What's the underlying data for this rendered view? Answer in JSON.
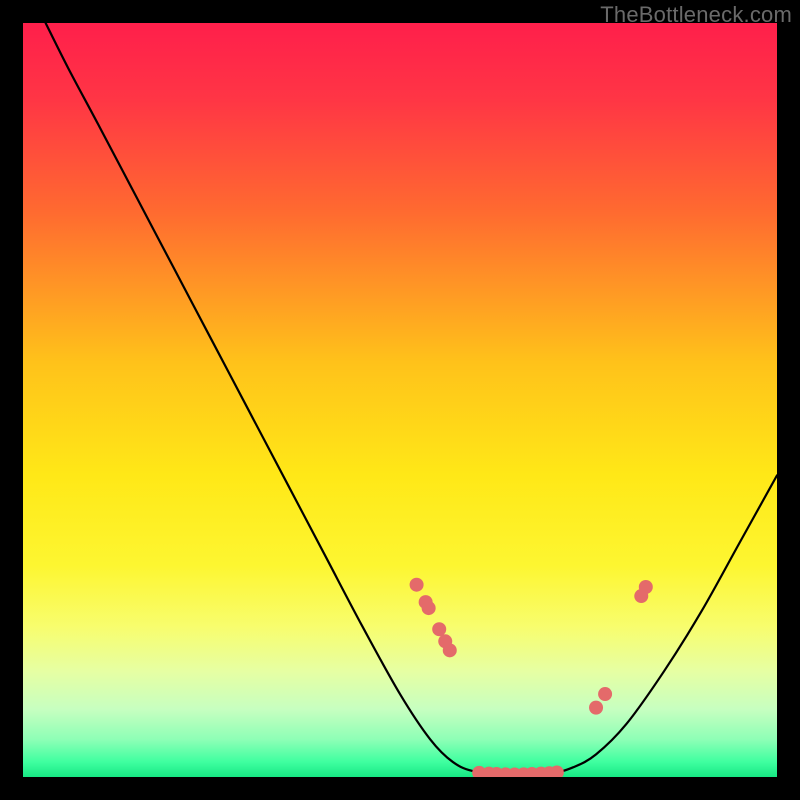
{
  "watermark": "TheBottleneck.com",
  "chart_data": {
    "type": "line",
    "title": "",
    "xlabel": "",
    "ylabel": "",
    "xlim": [
      0,
      100
    ],
    "ylim": [
      0,
      100
    ],
    "gradient_stops": [
      {
        "offset": 0.0,
        "color": "#ff1f4b"
      },
      {
        "offset": 0.1,
        "color": "#ff3545"
      },
      {
        "offset": 0.25,
        "color": "#ff6a30"
      },
      {
        "offset": 0.45,
        "color": "#ffc21a"
      },
      {
        "offset": 0.6,
        "color": "#ffe817"
      },
      {
        "offset": 0.72,
        "color": "#fdf631"
      },
      {
        "offset": 0.8,
        "color": "#f8fd6d"
      },
      {
        "offset": 0.86,
        "color": "#e6ffa3"
      },
      {
        "offset": 0.91,
        "color": "#c7ffc0"
      },
      {
        "offset": 0.95,
        "color": "#8effb6"
      },
      {
        "offset": 0.98,
        "color": "#3fffa0"
      },
      {
        "offset": 1.0,
        "color": "#17e884"
      }
    ],
    "curve": [
      {
        "x": 3.0,
        "y": 100.0
      },
      {
        "x": 6.0,
        "y": 94.0
      },
      {
        "x": 10.0,
        "y": 86.5
      },
      {
        "x": 15.0,
        "y": 77.0
      },
      {
        "x": 20.0,
        "y": 67.5
      },
      {
        "x": 25.0,
        "y": 58.0
      },
      {
        "x": 30.0,
        "y": 48.5
      },
      {
        "x": 35.0,
        "y": 39.0
      },
      {
        "x": 40.0,
        "y": 29.5
      },
      {
        "x": 45.0,
        "y": 20.0
      },
      {
        "x": 50.0,
        "y": 11.0
      },
      {
        "x": 54.0,
        "y": 5.0
      },
      {
        "x": 57.0,
        "y": 2.0
      },
      {
        "x": 60.0,
        "y": 0.7
      },
      {
        "x": 65.0,
        "y": 0.3
      },
      {
        "x": 70.0,
        "y": 0.5
      },
      {
        "x": 73.0,
        "y": 1.3
      },
      {
        "x": 76.0,
        "y": 3.0
      },
      {
        "x": 80.0,
        "y": 7.0
      },
      {
        "x": 85.0,
        "y": 14.0
      },
      {
        "x": 90.0,
        "y": 22.0
      },
      {
        "x": 95.0,
        "y": 31.0
      },
      {
        "x": 100.0,
        "y": 40.0
      }
    ],
    "markers": [
      {
        "x": 52.2,
        "y": 25.5
      },
      {
        "x": 53.4,
        "y": 23.2
      },
      {
        "x": 53.8,
        "y": 22.4
      },
      {
        "x": 55.2,
        "y": 19.6
      },
      {
        "x": 56.0,
        "y": 18.0
      },
      {
        "x": 56.6,
        "y": 16.8
      },
      {
        "x": 60.5,
        "y": 0.55
      },
      {
        "x": 61.8,
        "y": 0.45
      },
      {
        "x": 62.8,
        "y": 0.4
      },
      {
        "x": 64.0,
        "y": 0.35
      },
      {
        "x": 65.2,
        "y": 0.33
      },
      {
        "x": 66.4,
        "y": 0.35
      },
      {
        "x": 67.5,
        "y": 0.4
      },
      {
        "x": 68.7,
        "y": 0.45
      },
      {
        "x": 69.8,
        "y": 0.5
      },
      {
        "x": 70.8,
        "y": 0.6
      },
      {
        "x": 76.0,
        "y": 9.2
      },
      {
        "x": 77.2,
        "y": 11.0
      },
      {
        "x": 82.0,
        "y": 24.0
      },
      {
        "x": 82.6,
        "y": 25.2
      }
    ],
    "marker_color": "#e46a6a",
    "marker_radius": 7
  }
}
